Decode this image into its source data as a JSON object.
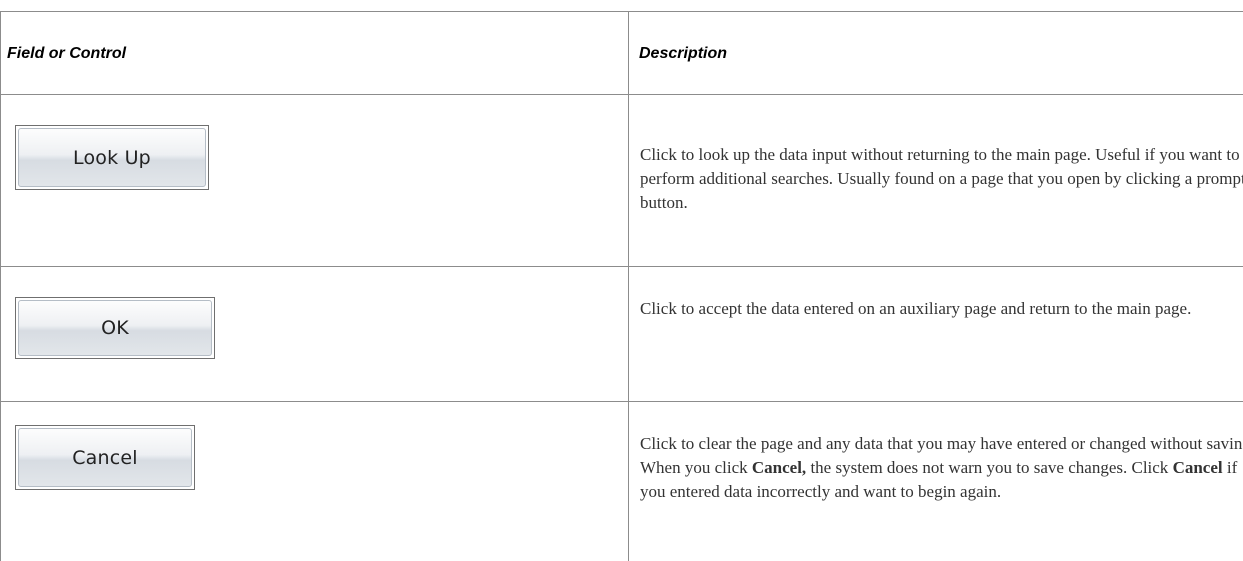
{
  "table": {
    "header": {
      "field_col": "Field or Control",
      "desc_col": "Description"
    },
    "rows": [
      {
        "button_label": "Look Up",
        "description": [
          {
            "text": "Click to look up the data input without returning to the main page. Useful if you want to perform additional searches.  Usually found on a page that you open by clicking a prompt button.",
            "bold": false
          }
        ]
      },
      {
        "button_label": "OK",
        "description": [
          {
            "text": "Click to accept the data entered on an auxiliary page and return to the main page.",
            "bold": false
          }
        ]
      },
      {
        "button_label": "Cancel",
        "description": [
          {
            "text": "Click to clear the page and any data that you may have entered or changed without saving. When you click ",
            "bold": false
          },
          {
            "text": "Cancel,",
            "bold": true
          },
          {
            "text": " the system does not warn you to save changes. Click ",
            "bold": false
          },
          {
            "text": "Cancel",
            "bold": true
          },
          {
            "text": " if you entered data incorrectly and want to begin again.",
            "bold": false
          }
        ]
      }
    ]
  },
  "colors": {
    "border": "#8c8c8c",
    "text": "#333333",
    "header_text": "#000000"
  }
}
